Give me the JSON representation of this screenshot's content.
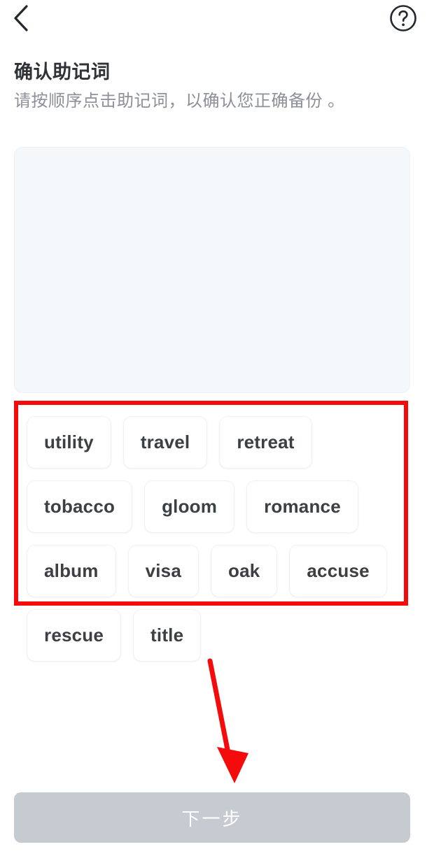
{
  "navbar": {
    "back_icon": "chevron-left-icon",
    "help_icon": "help-circle-icon"
  },
  "heading": {
    "title": "确认助记词",
    "subtitle": "请按顺序点击助记词，以确认您正确备份 。"
  },
  "answer_panel": {
    "selected_words": []
  },
  "word_bank": {
    "words": [
      "utility",
      "travel",
      "retreat",
      "tobacco",
      "gloom",
      "romance",
      "album",
      "visa",
      "oak",
      "accuse",
      "rescue",
      "title"
    ]
  },
  "footer": {
    "next_label": "下一步",
    "next_disabled": true
  },
  "annotations": {
    "highlight_box_color": "#f40c0c",
    "arrow_color": "#f40c0c"
  },
  "colors": {
    "page_background": "#ffffff",
    "title_text": "#2f3237",
    "subtitle_text": "#8c9099",
    "panel_background": "#f5f8fb",
    "chip_background": "#ffffff",
    "chip_text": "#3c4043",
    "button_disabled_background": "#c6cad1",
    "button_text": "#ffffff"
  }
}
